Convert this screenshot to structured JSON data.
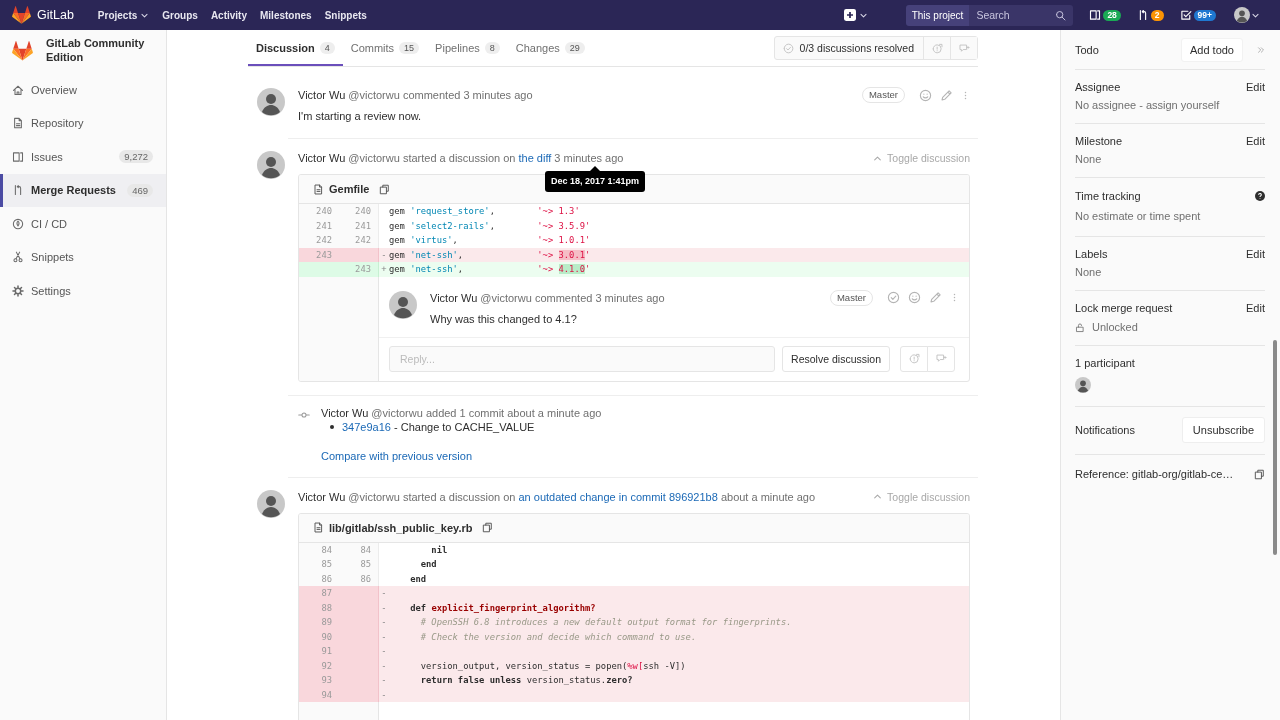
{
  "navbar": {
    "brand": "GitLab",
    "menu": [
      {
        "label": "Projects",
        "dropdown": true
      },
      {
        "label": "Groups",
        "dropdown": false
      },
      {
        "label": "Activity",
        "dropdown": false
      },
      {
        "label": "Milestones",
        "dropdown": false
      },
      {
        "label": "Snippets",
        "dropdown": false
      }
    ],
    "scope_button": "This project",
    "search": {
      "placeholder": "Search"
    },
    "counters": [
      {
        "count": "28",
        "color": "#1aaa55"
      },
      {
        "count": "2",
        "color": "#fc9403"
      },
      {
        "count": "99+",
        "color": "#1f78d1"
      }
    ]
  },
  "sidebar": {
    "project": "GitLab Community Edition",
    "items": [
      {
        "label": "Overview",
        "selected": false
      },
      {
        "label": "Repository",
        "selected": false
      },
      {
        "label": "Issues",
        "count": "9,272",
        "selected": false
      },
      {
        "label": "Merge Requests",
        "count": "469",
        "selected": true
      },
      {
        "label": "CI / CD",
        "selected": false
      },
      {
        "label": "Snippets",
        "selected": false
      },
      {
        "label": "Settings",
        "selected": false
      }
    ]
  },
  "tabs": [
    {
      "label": "Discussion",
      "count": "4",
      "selected": true
    },
    {
      "label": "Commits",
      "count": "15",
      "selected": false
    },
    {
      "label": "Pipelines",
      "count": "8",
      "selected": false
    },
    {
      "label": "Changes",
      "count": "29",
      "selected": false
    }
  ],
  "resolve_status": {
    "text": "0/3 discussions resolved"
  },
  "timeline": [
    {
      "kind": "note",
      "author": "Victor Wu",
      "username": "@victorwu",
      "action": "commented",
      "time": "3 minutes ago",
      "role": "Master",
      "body": "I'm starting a review now."
    },
    {
      "kind": "discussion",
      "author": "Victor Wu",
      "username": "@victorwu",
      "action": "started a discussion on",
      "link": "the diff",
      "time": "3 minutes ago",
      "tooltip": "Dec 18, 2017 1:41pm",
      "toggle": "Toggle discussion",
      "expanded": true,
      "file": {
        "name": "Gemfile",
        "lines": [
          {
            "old": "240",
            "new": "240",
            "kind": "context",
            "code": [
              {
                "text": "gem ",
                "kind": "plain"
              },
              {
                "text": "'request_store'",
                "kind": "name"
              },
              {
                "text": ",        ",
                "kind": "plain"
              },
              {
                "text": "'~> 1.3'",
                "kind": "string"
              }
            ]
          },
          {
            "old": "241",
            "new": "241",
            "kind": "context",
            "code": [
              {
                "text": "gem ",
                "kind": "plain"
              },
              {
                "text": "'select2-rails'",
                "kind": "name"
              },
              {
                "text": ",        ",
                "kind": "plain"
              },
              {
                "text": "'~> 3.5.9'",
                "kind": "string"
              }
            ]
          },
          {
            "old": "242",
            "new": "242",
            "kind": "context",
            "code": [
              {
                "text": "gem ",
                "kind": "plain"
              },
              {
                "text": "'virtus'",
                "kind": "name"
              },
              {
                "text": ",               ",
                "kind": "plain"
              },
              {
                "text": "'~> 1.0.1'",
                "kind": "string"
              }
            ]
          },
          {
            "old": "243",
            "kind": "removed",
            "sign": "-",
            "code": [
              {
                "text": "gem ",
                "kind": "plain"
              },
              {
                "text": "'net-ssh'",
                "kind": "name"
              },
              {
                "text": ",              ",
                "kind": "plain"
              },
              {
                "text": "'~> ",
                "kind": "string"
              },
              {
                "text": "3.0.1",
                "kind": "removed_text"
              },
              {
                "text": "'",
                "kind": "string"
              }
            ]
          },
          {
            "new": "243",
            "kind": "added",
            "sign": "+",
            "code": [
              {
                "text": "gem ",
                "kind": "plain"
              },
              {
                "text": "'net-ssh'",
                "kind": "name"
              },
              {
                "text": ",              ",
                "kind": "plain"
              },
              {
                "text": "'~> ",
                "kind": "string"
              },
              {
                "text": "4.1.0",
                "kind": "added_text"
              },
              {
                "text": "'",
                "kind": "string"
              }
            ]
          }
        ]
      },
      "replies": [
        {
          "author": "Victor Wu",
          "username": "@victorwu",
          "action": "commented",
          "time": "3 minutes ago",
          "role": "Master",
          "resolved": false,
          "body": "Why was this changed to 4.1?"
        }
      ],
      "reply": {
        "placeholder": "Reply...",
        "button": "Resolve discussion"
      }
    },
    {
      "kind": "system",
      "author": "Victor Wu",
      "username": "@victorwu",
      "action": "added 1 commit",
      "time": "about a minute ago",
      "commits": [
        {
          "sha": "347e9a16",
          "message": "- Change to CACHE_VALUE"
        }
      ],
      "compare_link": "Compare with previous version"
    },
    {
      "kind": "discussion",
      "author": "Victor Wu",
      "username": "@victorwu",
      "action": "started a discussion on",
      "link": "an outdated change in commit 896921b8",
      "time": "about a minute ago",
      "toggle": "Toggle discussion",
      "expanded": true,
      "file": {
        "name": "lib/gitlab/ssh_public_key.rb",
        "lines": [
          {
            "old": "84",
            "new": "84",
            "kind": "context",
            "code": [
              {
                "text": "        nil",
                "kind": "keyword"
              }
            ]
          },
          {
            "old": "85",
            "new": "85",
            "kind": "context",
            "code": [
              {
                "text": "      end",
                "kind": "keyword"
              }
            ]
          },
          {
            "old": "86",
            "new": "86",
            "kind": "context",
            "code": [
              {
                "text": "    end",
                "kind": "keyword"
              }
            ]
          },
          {
            "old": "87",
            "kind": "removed",
            "sign": "-"
          },
          {
            "old": "88",
            "kind": "removed",
            "sign": "-",
            "code": [
              {
                "text": "    def ",
                "kind": "keyword"
              },
              {
                "text": "explicit_fingerprint_algorithm?",
                "kind": "method"
              }
            ]
          },
          {
            "old": "89",
            "kind": "removed",
            "sign": "-",
            "code": [
              {
                "text": "      # OpenSSH 6.8 introduces a new default output format for fingerprints.",
                "kind": "comment"
              }
            ]
          },
          {
            "old": "90",
            "kind": "removed",
            "sign": "-",
            "code": [
              {
                "text": "      # Check the version and decide which command to use.",
                "kind": "comment"
              }
            ]
          },
          {
            "old": "91",
            "kind": "removed",
            "sign": "-"
          },
          {
            "old": "92",
            "kind": "removed",
            "sign": "-",
            "code": [
              {
                "text": "      version_output, version_status = popen(",
                "kind": "plain"
              },
              {
                "text": "%w[",
                "kind": "string"
              },
              {
                "text": "ssh -V])",
                "kind": "plain"
              }
            ]
          },
          {
            "old": "93",
            "kind": "removed",
            "sign": "-",
            "code": [
              {
                "text": "      return false unless",
                "kind": "keyword"
              },
              {
                "text": " version_status.",
                "kind": "plain"
              },
              {
                "text": "zero?",
                "kind": "keyword"
              }
            ]
          },
          {
            "old": "94",
            "kind": "removed",
            "sign": "-"
          }
        ]
      }
    }
  ],
  "right_sidebar": {
    "todo": {
      "label": "Todo",
      "button": "Add todo"
    },
    "blocks": [
      {
        "kind": "text",
        "title": "Assignee",
        "action": "Edit",
        "value": "No assignee - assign yourself"
      },
      {
        "kind": "text",
        "title": "Milestone",
        "action": "Edit",
        "value": "None"
      },
      {
        "kind": "help",
        "title": "Time tracking",
        "value": "No estimate or time spent"
      },
      {
        "kind": "text",
        "title": "Labels",
        "action": "Edit",
        "value": "None"
      },
      {
        "kind": "lock",
        "title": "Lock merge request",
        "action": "Edit",
        "value": "Unlocked"
      },
      {
        "kind": "participants",
        "title": "1 participant"
      },
      {
        "kind": "button",
        "title": "Notifications",
        "button": "Unsubscribe"
      },
      {
        "kind": "reference",
        "title": "Reference: gitlab-org/gitlab-ce…"
      }
    ]
  }
}
